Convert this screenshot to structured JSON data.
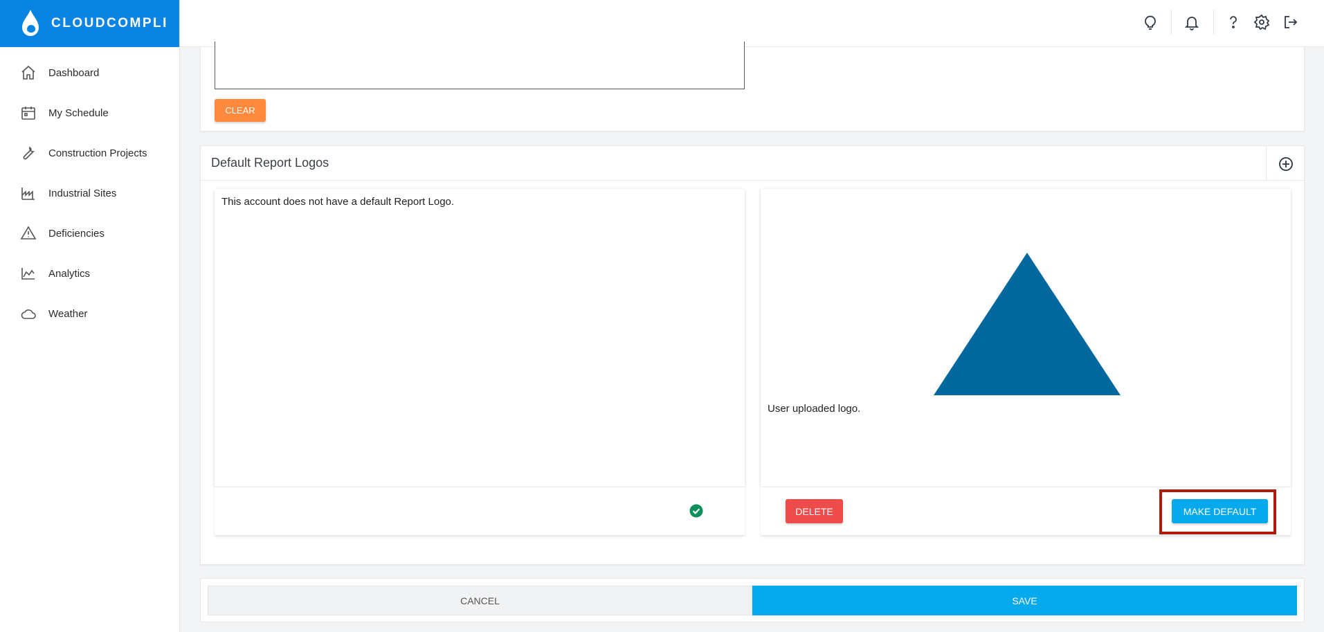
{
  "brand": {
    "name": "CLOUDCOMPLI",
    "color": "#0a84e3"
  },
  "sidebar": {
    "items": [
      {
        "label": "Dashboard",
        "icon": "home-icon"
      },
      {
        "label": "My Schedule",
        "icon": "calendar-icon"
      },
      {
        "label": "Construction Projects",
        "icon": "wrench-icon"
      },
      {
        "label": "Industrial Sites",
        "icon": "factory-icon"
      },
      {
        "label": "Deficiencies",
        "icon": "warning-icon"
      },
      {
        "label": "Analytics",
        "icon": "area-chart-icon"
      },
      {
        "label": "Weather",
        "icon": "cloud-icon"
      }
    ]
  },
  "header": {
    "icons": [
      "lightbulb-icon",
      "bell-icon",
      "help-icon",
      "gear-icon",
      "logout-icon"
    ]
  },
  "signature": {
    "clear_label": "CLEAR"
  },
  "logos": {
    "title": "Default Report Logos",
    "add_icon": "plus-circle-icon",
    "left_panel": {
      "text": "This account does not have a default Report Logo."
    },
    "right_panel": {
      "caption": "User uploaded logo.",
      "logo_color": "#03689e",
      "delete_label": "DELETE",
      "make_default_label": "MAKE DEFAULT"
    }
  },
  "footer": {
    "cancel_label": "CANCEL",
    "save_label": "SAVE"
  },
  "colors": {
    "accent": "#05a9ec",
    "danger": "#ee4b4b",
    "warning": "#ff8a3d",
    "success": "#0d8f5b"
  }
}
